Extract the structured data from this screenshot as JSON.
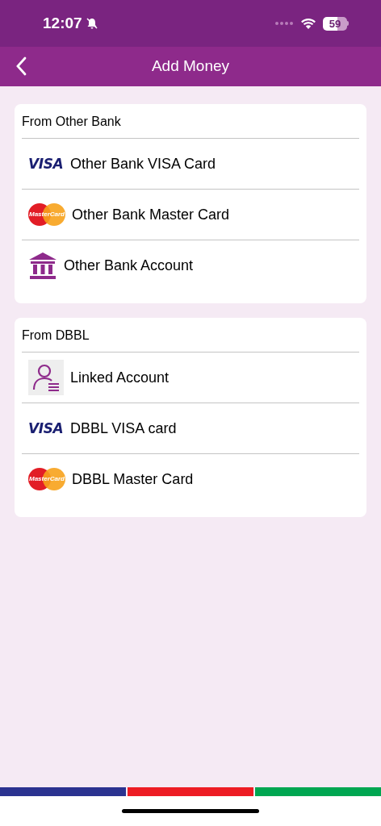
{
  "status_bar": {
    "time": "12:07",
    "battery": "59"
  },
  "nav": {
    "title": "Add Money"
  },
  "sections": [
    {
      "title": "From Other Bank",
      "items": [
        {
          "kind": "visa",
          "logo_text": "VISA",
          "label": "Other Bank VISA Card"
        },
        {
          "kind": "mastercard",
          "logo_text": "MasterCard",
          "label": "Other Bank Master Card"
        },
        {
          "kind": "bank",
          "label": "Other Bank Account"
        }
      ]
    },
    {
      "title": "From DBBL",
      "items": [
        {
          "kind": "linked",
          "label": "Linked Account"
        },
        {
          "kind": "visa",
          "logo_text": "VISA",
          "label": "DBBL VISA card"
        },
        {
          "kind": "mastercard",
          "logo_text": "MasterCard",
          "label": "DBBL Master Card"
        }
      ]
    }
  ]
}
